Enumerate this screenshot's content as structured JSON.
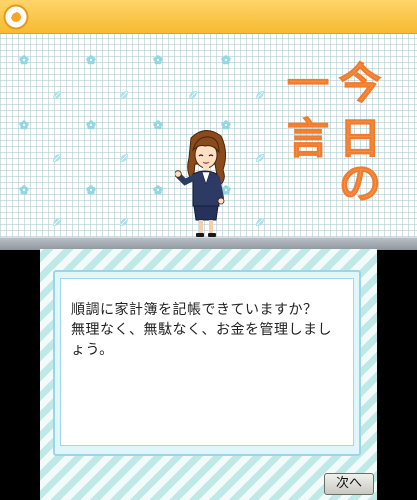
{
  "top_screen": {
    "title_chars": [
      "今",
      "日",
      "の",
      "一",
      "言"
    ],
    "colors": {
      "bar": "#f6bb30",
      "title": "#f7924a",
      "background": "#ffffff"
    },
    "icons": {
      "home": "home-circle-icon",
      "decor": [
        "flower-icon",
        "leaf-icon"
      ]
    }
  },
  "bottom_screen": {
    "message": "順調に家計簿を記帳できていますか？\n無理なく、無駄なく、お金を管理しましょう。",
    "next_label": "次へ",
    "colors": {
      "stripe": "#bfe9e6",
      "frame": "#9bd5ea"
    }
  }
}
